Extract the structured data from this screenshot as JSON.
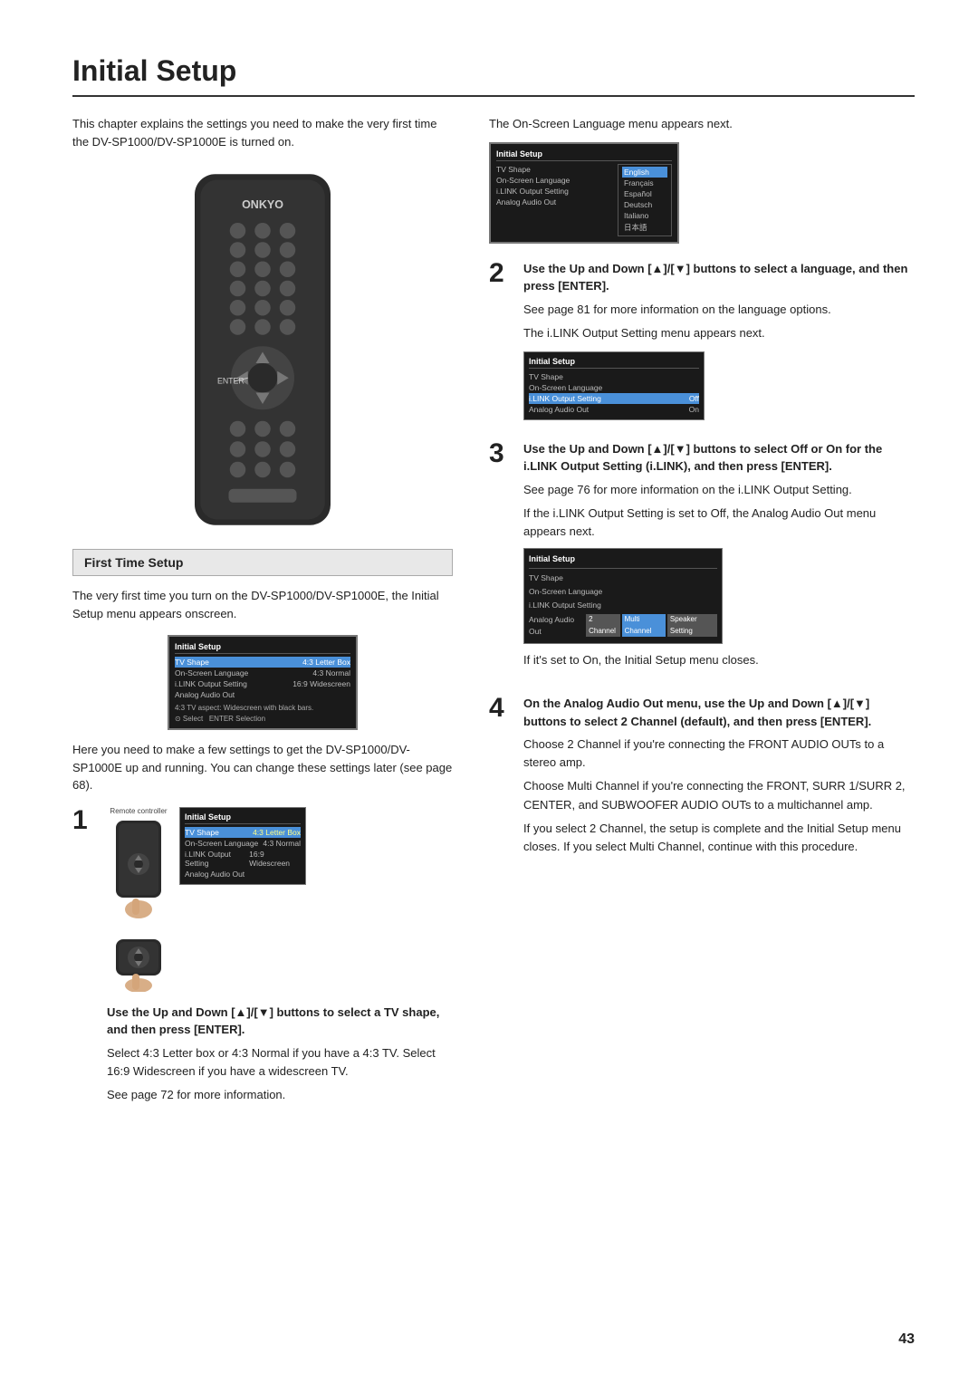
{
  "page": {
    "title": "Initial Setup",
    "page_number": "43"
  },
  "intro": {
    "text": "This chapter explains the settings you need to make the very first time the DV-SP1000/DV-SP1000E is turned on."
  },
  "first_time_setup": {
    "heading": "First Time Setup",
    "text": "The very first time you turn on the DV-SP1000/DV-SP1000E, the Initial Setup menu appears onscreen.",
    "text2": "Here you need to make a few settings to get the DV-SP1000/DV-SP1000E up and running. You can change these settings later (see page 68)."
  },
  "steps": {
    "step1": {
      "number": "1",
      "label": "Remote controller",
      "title": "Use the Up and Down [▲]/[▼] buttons to select a TV shape, and then press [ENTER].",
      "body1": "Select 4:3 Letter box or 4:3 Normal if you have a 4:3 TV. Select 16:9 Widescreen if you have a widescreen TV.",
      "body2": "See page 72 for more information.",
      "screen": {
        "title": "Initial Setup",
        "rows": [
          {
            "label": "TV Shape",
            "value": "4:3 Letter Box",
            "highlight": true
          },
          {
            "label": "On-Screen Language",
            "value": "4:3 Normal",
            "highlight": false
          },
          {
            "label": "i.LINK Output Setting",
            "value": "16:9 Widescreen",
            "highlight": false
          },
          {
            "label": "Analog Audio Out",
            "value": "",
            "highlight": false
          }
        ],
        "caption": "4:3 TV aspect: Widescreen with black bars.",
        "caption2": "⊙ Select  ENTER Selection"
      }
    },
    "step2": {
      "number": "2",
      "title": "Use the Up and Down [▲]/[▼] buttons to select a language, and then press [ENTER].",
      "body1": "See page 81 for more information on the language options.",
      "body2": "The i.LINK Output Setting menu appears next.",
      "screen_top": {
        "title": "Initial Setup",
        "rows": [
          {
            "label": "TV Shape",
            "value": ""
          },
          {
            "label": "On-Screen Language",
            "value": ""
          },
          {
            "label": "i.LINK Output Setting",
            "value": ""
          },
          {
            "label": "Analog Audio Out",
            "value": ""
          }
        ],
        "languages": [
          "English",
          "Français",
          "Español",
          "Deutsch",
          "Italiano",
          "日本語"
        ],
        "selected_lang": "English"
      },
      "screen_bottom": {
        "title": "Initial Setup",
        "rows": [
          {
            "label": "TV Shape",
            "value": "",
            "highlight": false
          },
          {
            "label": "On-Screen Language",
            "value": "",
            "highlight": false
          },
          {
            "label": "i.LINK Output Setting",
            "value": "Off",
            "highlight": true
          },
          {
            "label": "Analog Audio Out",
            "value": "On",
            "highlight": false
          }
        ]
      }
    },
    "step3": {
      "number": "3",
      "title": "Use the Up and Down [▲]/[▼] buttons to select Off or On for the i.LINK Output Setting (i.LINK), and then press [ENTER].",
      "body1": "See page 76 for more information on the i.LINK Output Setting.",
      "body2": "If the i.LINK Output Setting is set to Off, the Analog Audio Out menu appears next.",
      "body3": "If it's set to On, the Initial Setup menu closes.",
      "screen": {
        "title": "Initial Setup",
        "rows": [
          {
            "label": "TV Shape",
            "value": "",
            "highlight": false
          },
          {
            "label": "On-Screen Language",
            "value": "",
            "highlight": false
          },
          {
            "label": "i.LINK Output Setting",
            "value": "",
            "highlight": false
          },
          {
            "label": "Analog Audio Out",
            "value": "2 Channel",
            "highlight": false
          },
          {
            "label": "",
            "value": "Multi Channel",
            "highlight": true
          },
          {
            "label": "",
            "value": "Speaker Setting",
            "highlight": false
          }
        ]
      }
    },
    "step4": {
      "number": "4",
      "title": "On the Analog Audio Out menu, use the Up and Down [▲]/[▼] buttons to select 2 Channel (default), and then press [ENTER].",
      "body1": "Choose 2 Channel if you're connecting the FRONT AUDIO OUTs to a stereo amp.",
      "body2": "Choose Multi Channel if you're connecting the FRONT, SURR 1/SURR 2, CENTER, and SUBWOOFER AUDIO OUTs to a multichannel amp.",
      "body3": "If you select 2 Channel, the setup is complete and the Initial Setup menu closes. If you select Multi Channel, continue with this procedure."
    }
  },
  "right_intro": {
    "text": "The On-Screen Language menu appears next."
  }
}
